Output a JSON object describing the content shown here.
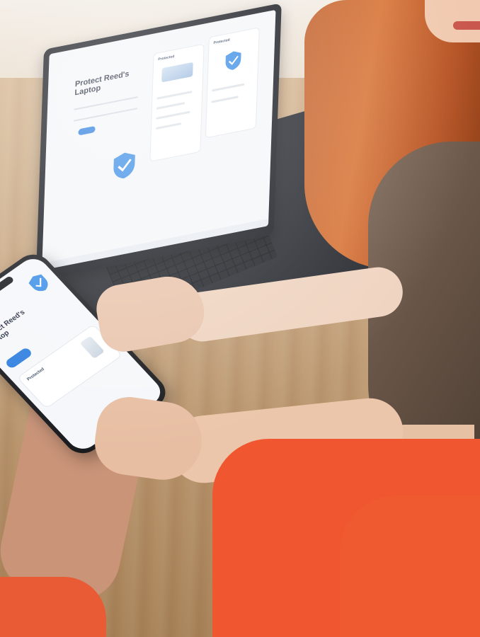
{
  "laptop": {
    "subtitle": "",
    "title": "Protect Reed's Laptop",
    "card1_label": "Protected",
    "card2_label": "Protected"
  },
  "phone": {
    "title": "Protect Reed's Laptop",
    "card_label": "Protected"
  },
  "colors": {
    "accent": "#2f7fe0",
    "shield": "#3d8fe6",
    "shirt": "#f0562f"
  }
}
